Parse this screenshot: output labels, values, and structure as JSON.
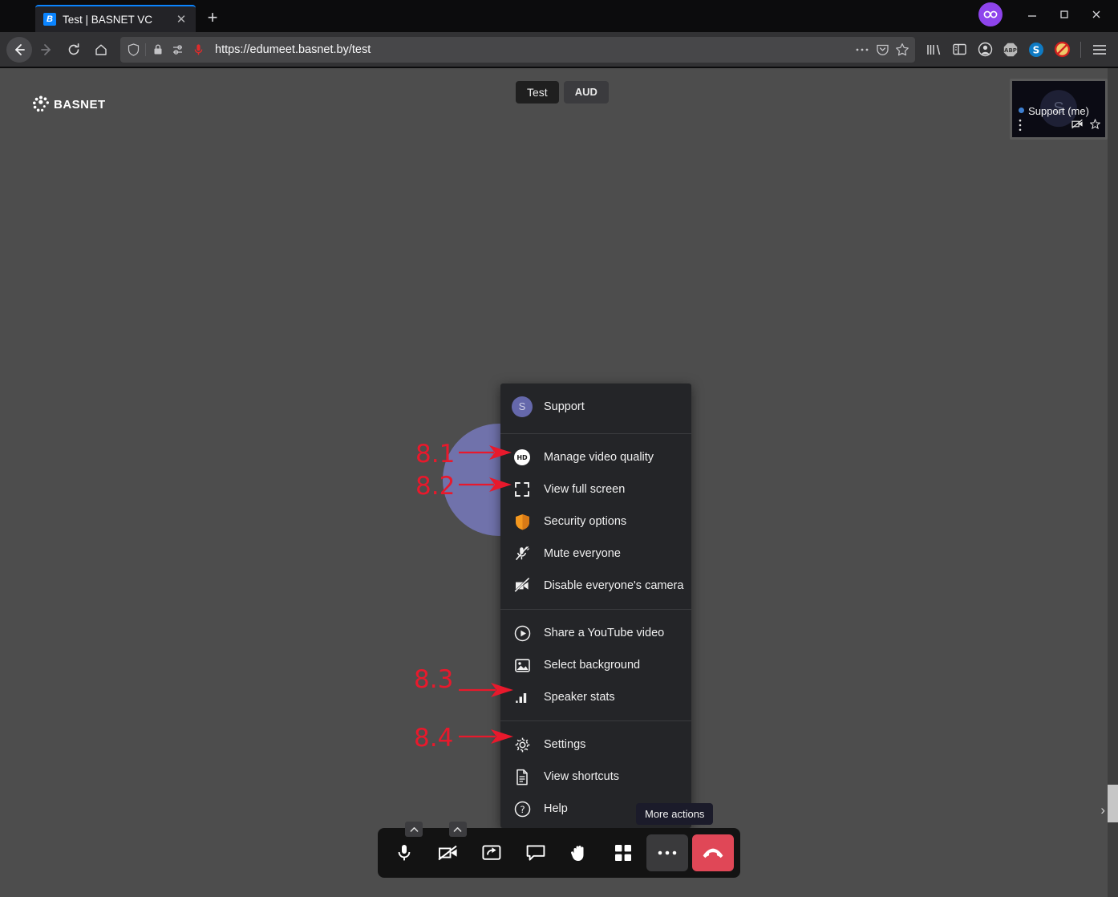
{
  "browser": {
    "tab": {
      "title": "Test | BASNET VC",
      "favicon_letter": "B",
      "close_icon": "✕"
    },
    "new_tab_icon": "+",
    "window_controls": {
      "mask_icon": "mask-icon",
      "minimize": "—",
      "maximize": "❐",
      "close": "✕"
    },
    "nav": {
      "back_icon": "back-arrow-icon",
      "forward_icon": "forward-arrow-icon",
      "reload_icon": "reload-icon",
      "home_icon": "home-icon"
    },
    "url": "https://edumeet.basnet.by/test",
    "url_icons": [
      "shield-icon",
      "padlock-icon",
      "permissions-icon",
      "microphone-active-icon"
    ],
    "url_right_icons": [
      "page-actions-icon",
      "pocket-icon",
      "bookmark-star-icon"
    ],
    "toolbar_icons": [
      "library-icon",
      "sidebar-icon",
      "account-icon",
      "adblock-plus-icon",
      "skype-icon",
      "noscript-icon",
      "hamburger-menu-icon"
    ],
    "adblock_label": "ABP",
    "skype_label": "S"
  },
  "app": {
    "logo_text": "BASNET",
    "room": {
      "name": "Test",
      "badge": "AUD"
    },
    "self_tile": {
      "name": "Support (me)",
      "avatar_letter": "S",
      "menu_icon": "vertical-dots-icon",
      "camera_off_icon": "camera-off-icon",
      "star_icon": "star-icon"
    },
    "menu": {
      "header": {
        "label": "Support",
        "avatar_letter": "S"
      },
      "groups": [
        {
          "items": [
            {
              "label": "Manage video quality",
              "icon": "hd-icon"
            },
            {
              "label": "View full screen",
              "icon": "fullscreen-icon"
            },
            {
              "label": "Security options",
              "icon": "shield-icon"
            },
            {
              "label": "Mute everyone",
              "icon": "mic-off-icon"
            },
            {
              "label": "Disable everyone's camera",
              "icon": "camera-off-icon"
            }
          ]
        },
        {
          "items": [
            {
              "label": "Share a YouTube video",
              "icon": "play-circle-icon"
            },
            {
              "label": "Select background",
              "icon": "image-icon"
            },
            {
              "label": "Speaker stats",
              "icon": "bar-chart-icon"
            }
          ]
        },
        {
          "items": [
            {
              "label": "Settings",
              "icon": "gear-icon"
            },
            {
              "label": "View shortcuts",
              "icon": "document-icon"
            },
            {
              "label": "Help",
              "icon": "question-circle-icon"
            }
          ]
        }
      ]
    },
    "tooltip": "More actions",
    "toolbar": [
      {
        "name": "microphone-button",
        "icon": "microphone-icon",
        "has_caret": true,
        "style": "plain"
      },
      {
        "name": "camera-button",
        "icon": "camera-off-icon",
        "has_caret": true,
        "style": "plain"
      },
      {
        "name": "screen-share-button",
        "icon": "screen-share-icon",
        "has_caret": false,
        "style": "plain"
      },
      {
        "name": "chat-button",
        "icon": "chat-icon",
        "has_caret": false,
        "style": "plain"
      },
      {
        "name": "raise-hand-button",
        "icon": "raise-hand-icon",
        "has_caret": false,
        "style": "plain"
      },
      {
        "name": "tile-view-button",
        "icon": "tile-view-icon",
        "has_caret": false,
        "style": "plain"
      },
      {
        "name": "more-actions-button",
        "icon": "ellipsis-icon",
        "has_caret": false,
        "style": "more"
      },
      {
        "name": "hangup-button",
        "icon": "hangup-phone-icon",
        "has_caret": false,
        "style": "hangup"
      }
    ],
    "chevron_right": "›"
  },
  "annotations": [
    {
      "label": "8.1",
      "target": "Manage video quality"
    },
    {
      "label": "8.2",
      "target": "View full screen"
    },
    {
      "label": "8.3",
      "target": "Speaker stats"
    },
    {
      "label": "8.4",
      "target": "Settings"
    }
  ],
  "colors": {
    "annotation_red": "#e8192c",
    "hangup_red": "#e04757",
    "accent_blue": "#0a84ff",
    "avatar_purple": "#6568ab",
    "page_background": "#4d4d4d",
    "menu_background": "#242528"
  }
}
